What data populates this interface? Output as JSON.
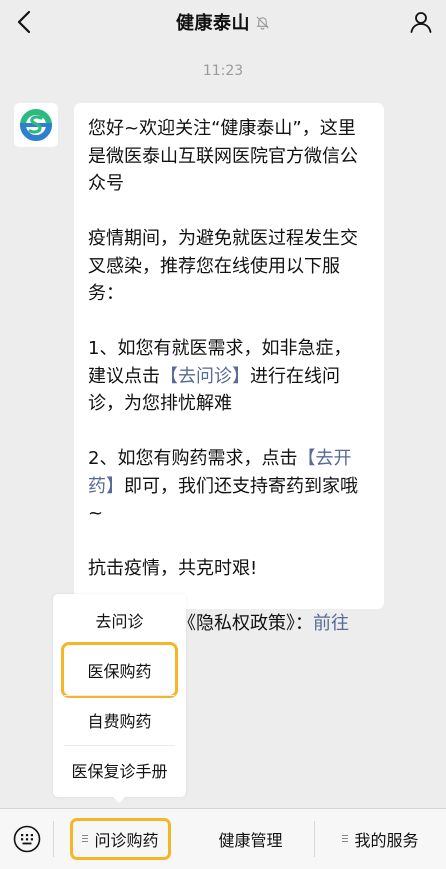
{
  "header": {
    "title": "健康泰山",
    "back_icon": "chevron-left-icon",
    "mute_icon": "bell-muted-icon",
    "profile_icon": "person-icon"
  },
  "chat": {
    "timestamp": "11:23",
    "message": {
      "p1": "您好~欢迎关注“健康泰山”，这里是微医泰山互联网医院官方微信公众号",
      "p2": "疫情期间，为避免就医过程发生交叉感染，推荐您在线使用以下服务：",
      "p3_before": "1、如您有就医需求，如非急症，建议点击",
      "p3_link": "【去问诊】",
      "p3_after": "进行在线问诊，为您排忧解难",
      "p4_before": "2、如您有购药需求，点击",
      "p4_link": "【去开药】",
      "p4_after": "即可，我们还支持寄药到家哦~",
      "p5": "抗击疫情，共克时艰!",
      "p6_before": "请务必阅读《隐私权政策》：",
      "p6_link": "前往>>"
    }
  },
  "submenu": {
    "items": [
      "去问诊",
      "医保购药",
      "自费购药",
      "医保复诊手册"
    ]
  },
  "menubar": {
    "keyboard_icon": "keyboard-icon",
    "tabs": [
      "问诊购药",
      "健康管理",
      "我的服务"
    ]
  },
  "colors": {
    "background": "#ededed",
    "link": "#576b95",
    "highlight": "#f4b527",
    "logo_green": "#2dba7e",
    "logo_blue": "#2f7fd1"
  }
}
